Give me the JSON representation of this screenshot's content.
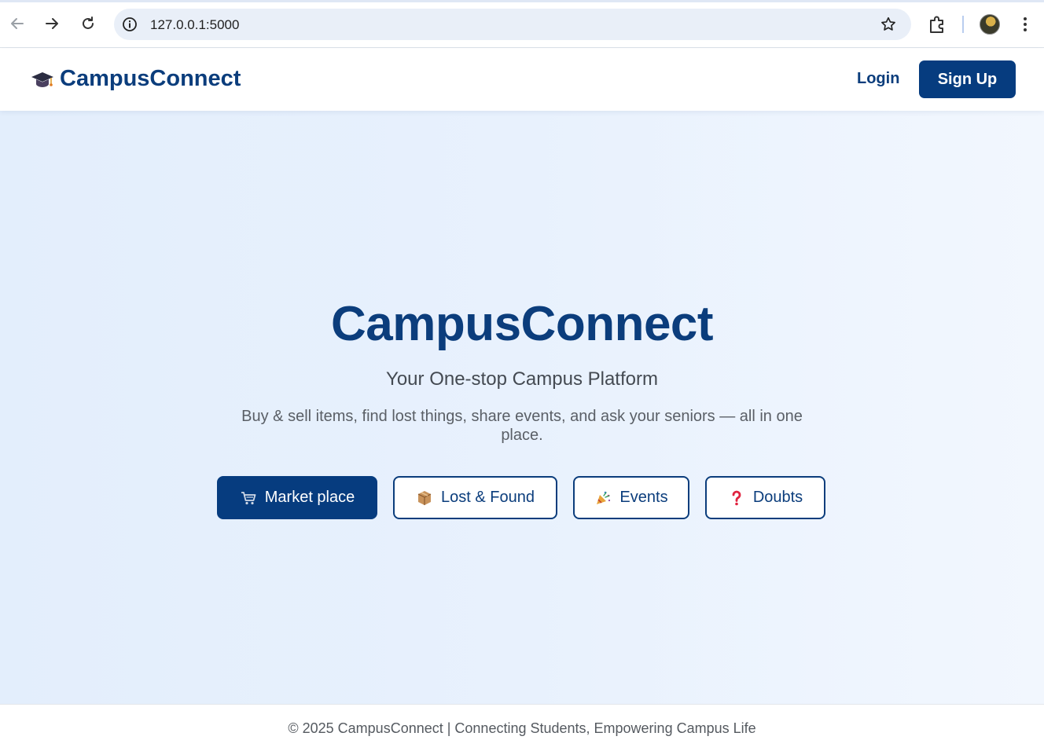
{
  "browser": {
    "url": "127.0.0.1:5000",
    "icons": [
      "back-arrow-icon",
      "forward-arrow-icon",
      "reload-icon",
      "site-info-icon",
      "bookmark-star-icon",
      "extensions-icon",
      "profile-avatar",
      "more-menu-icon"
    ]
  },
  "header": {
    "brand_name": "CampusConnect",
    "brand_icon": "graduation-cap-icon",
    "login_label": "Login",
    "signup_label": "Sign Up"
  },
  "hero": {
    "title": "CampusConnect",
    "subtitle": "Your One-stop Campus Platform",
    "description": "Buy & sell items, find lost things, share events, and ask your seniors — all in one place.",
    "buttons": [
      {
        "label": "Market place",
        "icon": "shopping-cart-icon",
        "style": "primary"
      },
      {
        "label": "Lost & Found",
        "icon": "package-icon",
        "style": "outline"
      },
      {
        "label": "Events",
        "icon": "party-popper-icon",
        "style": "outline"
      },
      {
        "label": "Doubts",
        "icon": "question-mark-icon",
        "style": "outline"
      }
    ]
  },
  "footer": {
    "text": "© 2025 CampusConnect | Connecting Students, Empowering Campus Life"
  },
  "colors": {
    "brand": "#0b3d7c",
    "primary_button": "#063c7f",
    "hero_background": "#e8f1fd",
    "text_muted": "#5a5f66"
  }
}
